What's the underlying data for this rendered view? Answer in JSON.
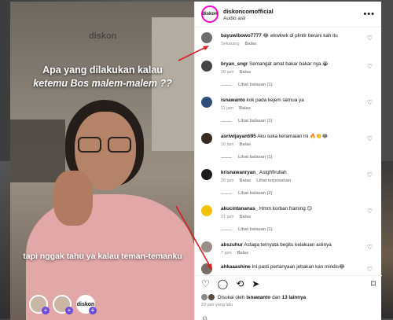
{
  "video": {
    "brand": "diskon",
    "caption_line1": "Apa yang dilakukan kalau",
    "caption_line2": "ketemu Bos malem-malem ??",
    "caption_bottom": "tapi nggak tahu ya kalau teman-temanku",
    "avatar_logo": "diskon"
  },
  "header": {
    "username": "diskoncomofficial",
    "subtitle": "Audio asli",
    "logo": "diskon",
    "more": "•••"
  },
  "comments": [
    {
      "user": "bayuwibowo7777",
      "text": "😂 wkwkwk di plintir berani kah itu",
      "time": "Sekarang",
      "reply": "Balas",
      "extra": ""
    },
    {
      "user": "bryan_sngr",
      "text": "Semangat amat bakar bakar nya 😭",
      "time": "18 jam",
      "reply": "Balas",
      "extra": "",
      "view": "Lihat balasan (1)"
    },
    {
      "user": "isnawanto",
      "text": "kok pada kejem semua ya",
      "time": "11 jam",
      "reply": "Balas",
      "extra": "",
      "view": "Lihat balasan (1)"
    },
    {
      "user": "asriwijayanti95",
      "text": "Aku suka keramaian ini 🔥👏😂",
      "time": "10 jam",
      "reply": "Balas",
      "extra": "",
      "view": "Lihat balasan (1)"
    },
    {
      "user": "krisnawanryan_",
      "text": "Astghfirullah",
      "time": "20 jam",
      "reply": "Balas",
      "extra": "Lihat terjemahan",
      "view": "Lihat balasan (2)"
    },
    {
      "user": "akucintananas_",
      "text": "Hmm korban framing 😏",
      "time": "21 jam",
      "reply": "Balas",
      "extra": "",
      "view": "Lihat balasan (1)"
    },
    {
      "user": "abszuhur",
      "text": "Astaga ternyata begitu kelakuan aslinya",
      "time": "7 jam",
      "reply": "Balas",
      "extra": "",
      "view": ""
    },
    {
      "user": "ahkaaashine",
      "text": "Ini pasti pertanyaan jebakan kan mindis😂",
      "time": "",
      "reply": "",
      "extra": "",
      "view": ""
    }
  ],
  "likes": {
    "prefix": "Disukai oleh",
    "user": "isnawanto",
    "and": "dan",
    "count": "13 lainnya"
  },
  "time_ago": "23 jam yang lalu",
  "icons": {
    "like": "heart-icon",
    "comment": "comment-icon",
    "repost": "repost-icon",
    "share": "share-icon",
    "save": "bookmark-icon"
  },
  "colors": {
    "arrow": "#d61f1f",
    "muted": "#8e8e8e"
  }
}
